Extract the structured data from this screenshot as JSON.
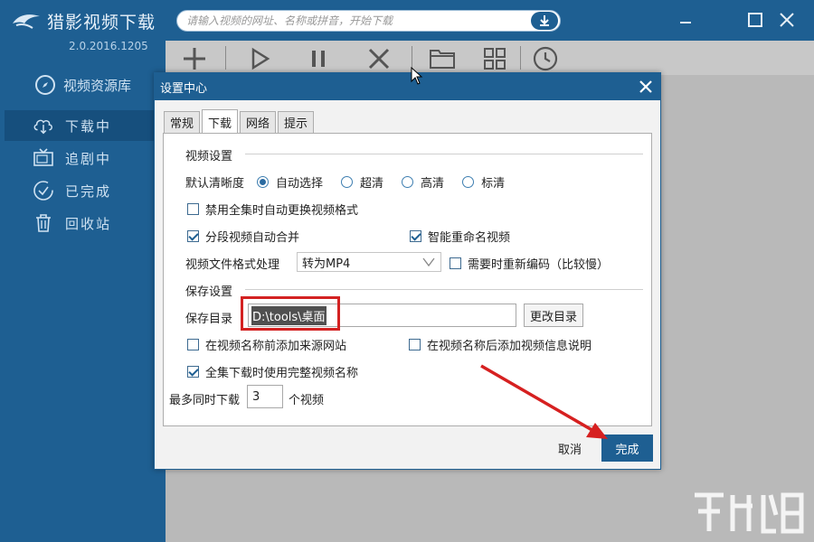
{
  "app": {
    "title": "猎影视频下载",
    "version": "2.0.2016.1205"
  },
  "sidebar": {
    "items": [
      {
        "label": "视频资源库",
        "icon": "compass-icon"
      },
      {
        "label": "下载中",
        "icon": "cloud-download-icon"
      },
      {
        "label": "追剧中",
        "icon": "tv-icon"
      },
      {
        "label": "已完成",
        "icon": "check-circle-icon"
      },
      {
        "label": "回收站",
        "icon": "trash-icon"
      }
    ]
  },
  "search": {
    "placeholder": "请输入视频的网址、名称或拼音，开始下载"
  },
  "toolbar": {
    "icons": [
      "plus-icon",
      "play-icon",
      "pause-icon",
      "delete-icon",
      "folder-icon",
      "grid-icon",
      "clock-icon"
    ]
  },
  "dialog": {
    "title": "设置中心",
    "tabs": [
      "常规",
      "下载",
      "网络",
      "提示"
    ],
    "video_settings": {
      "heading": "视频设置",
      "quality_label": "默认清晰度",
      "quality_options": [
        "自动选择",
        "超清",
        "高清",
        "标清"
      ],
      "quality_selected": "自动选择",
      "disable_auto_format": "禁用全集时自动更换视频格式",
      "auto_merge": "分段视频自动合并",
      "smart_rename": "智能重命名视频",
      "format_label": "视频文件格式处理",
      "format_value": "转为MP4",
      "reencode": "需要时重新编码（比较慢）"
    },
    "save_settings": {
      "heading": "保存设置",
      "dir_label": "保存目录",
      "dir_value": "D:\\tools\\桌面",
      "change_dir": "更改目录",
      "add_source": "在视频名称前添加来源网站",
      "add_info": "在视频名称后添加视频信息说明",
      "full_name": "全集下载时使用完整视频名称",
      "max_label": "最多同时下载",
      "max_value": "3",
      "max_unit": "个视频"
    },
    "cancel": "取消",
    "done": "完成"
  },
  "colors": {
    "brand": "#1e5f92",
    "highlight": "#d32222"
  }
}
